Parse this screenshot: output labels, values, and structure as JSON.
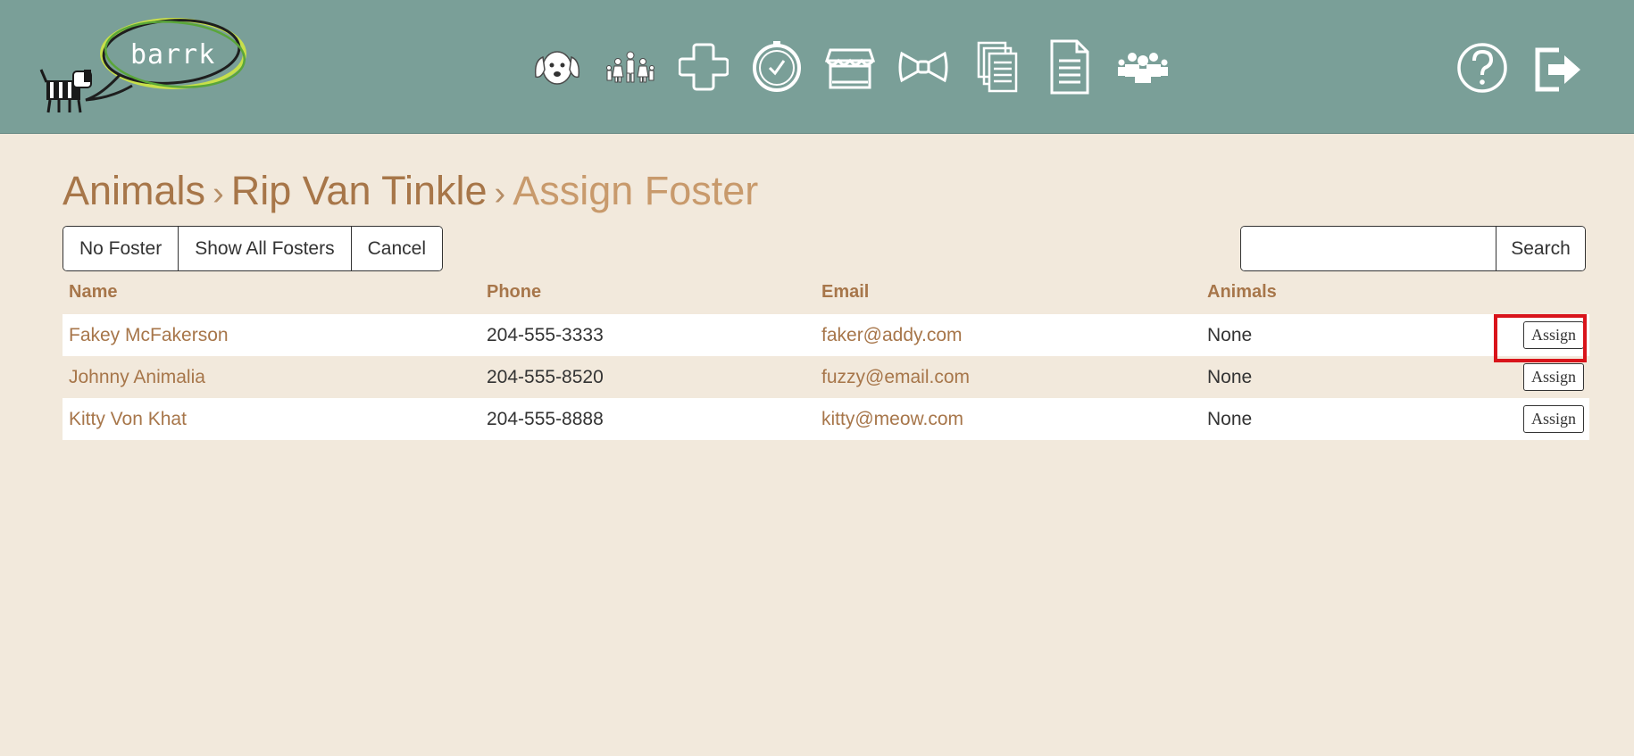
{
  "app": {
    "logo_text": "barrk"
  },
  "nav": {
    "icons": [
      {
        "name": "animals-icon"
      },
      {
        "name": "people-icon"
      },
      {
        "name": "medical-icon"
      },
      {
        "name": "schedule-icon"
      },
      {
        "name": "store-icon"
      },
      {
        "name": "bowtie-icon"
      },
      {
        "name": "documents-icon"
      },
      {
        "name": "document-icon"
      },
      {
        "name": "users-icon"
      }
    ],
    "right_icons": [
      {
        "name": "help-icon"
      },
      {
        "name": "logout-icon"
      }
    ]
  },
  "breadcrumb": {
    "items": [
      "Animals",
      "Rip Van Tinkle"
    ],
    "separator": "›",
    "current": "Assign Foster"
  },
  "toolbar": {
    "no_foster_label": "No Foster",
    "show_all_label": "Show All Fosters",
    "cancel_label": "Cancel"
  },
  "search": {
    "value": "",
    "placeholder": "",
    "button_label": "Search"
  },
  "table": {
    "columns": [
      "Name",
      "Phone",
      "Email",
      "Animals"
    ],
    "rows": [
      {
        "name": "Fakey McFakerson",
        "phone": "204-555-3333",
        "email": "faker@addy.com",
        "animals": "None",
        "action": "Assign",
        "highlighted": true
      },
      {
        "name": "Johnny Animalia",
        "phone": "204-555-8520",
        "email": "fuzzy@email.com",
        "animals": "None",
        "action": "Assign",
        "highlighted": false
      },
      {
        "name": "Kitty Von Khat",
        "phone": "204-555-8888",
        "email": "kitty@meow.com",
        "animals": "None",
        "action": "Assign",
        "highlighted": false
      }
    ]
  },
  "colors": {
    "header_bg": "#7a9f98",
    "page_bg": "#f2e9dc",
    "accent": "#a7764a",
    "highlight": "#d9141b"
  }
}
